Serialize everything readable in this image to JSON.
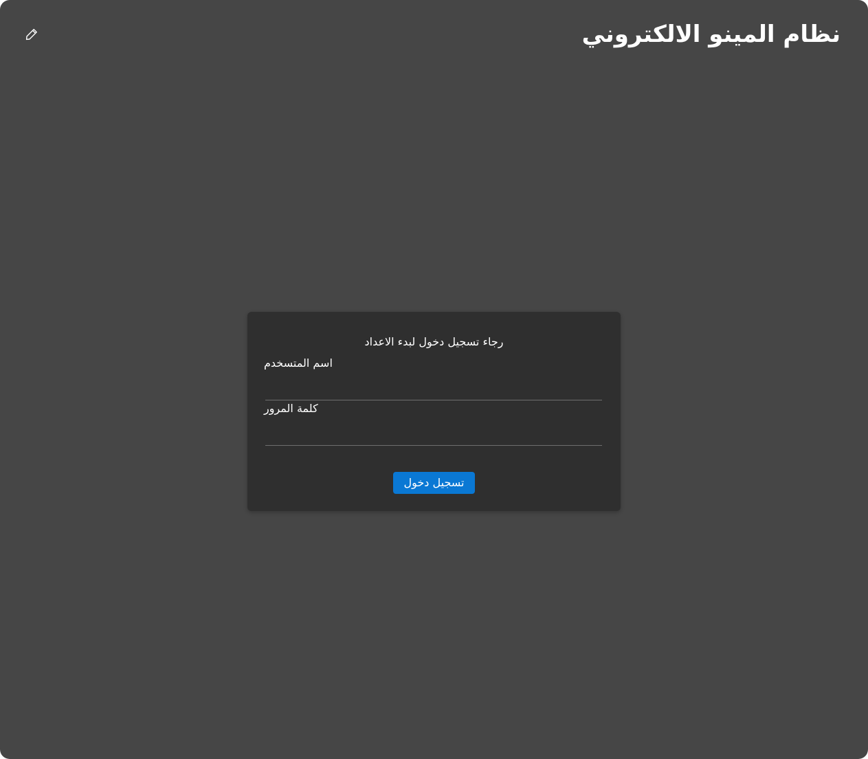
{
  "header": {
    "title": "نظام المينو الالكتروني",
    "edit_icon": "pencil-icon"
  },
  "login": {
    "prompt": "رجاء تسجيل دخول لبدء الاعداد",
    "username_label": "اسم المتسخدم",
    "username_value": "",
    "password_label": "كلمة المرور",
    "password_value": "",
    "submit_label": "تسجيل دخول"
  },
  "colors": {
    "background": "#464646",
    "card": "#2f2f2f",
    "accent": "#0a78d4",
    "text": "#ffffff"
  }
}
